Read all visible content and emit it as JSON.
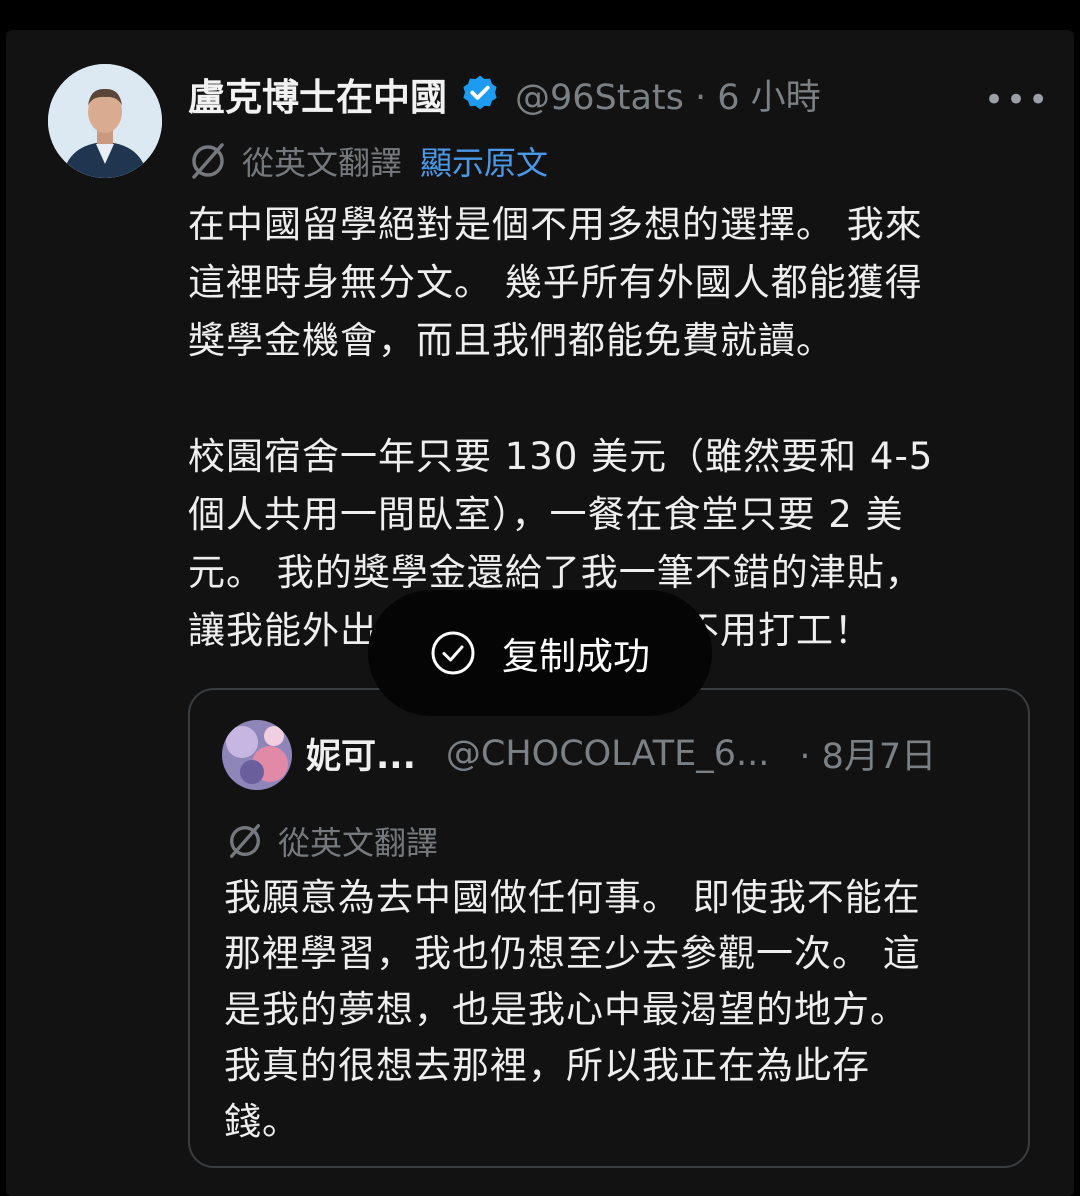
{
  "tweet": {
    "display_name": "盧克博士在中國",
    "handle_time": "@96Stats · 6 小時",
    "more": "•••",
    "translated_label": "從英文翻譯",
    "show_original": "顯示原文",
    "paragraph1": [
      "在中國留學絕對是個不用多想的選擇。 我來",
      "這裡時身無分文。 幾乎所有外國人都能獲得",
      "獎學金機會，而且我們都能免費就讀。"
    ],
    "paragraph2": [
      "校園宿舍一年只要 130 美元（雖然要和 4-5",
      "個人共用一間臥室），一餐在食堂只要 2 美",
      "元。 我的獎學金還給了我一筆不錯的津貼，",
      "讓我能外出好好享受生活，也不用打工！"
    ]
  },
  "toast": {
    "text": "复制成功"
  },
  "quoted": {
    "display_name": "妮可...",
    "handle": "@CHOCOLATE_6...",
    "date": "· 8月7日",
    "translated_label": "從英文翻譯",
    "lines": [
      "我願意為去中國做任何事。 即使我不能在",
      "那裡學習，我也仍想至少去參觀一次。 這",
      "是我的夢想，也是我心中最渴望的地方。",
      "我真的很想去那裡，所以我正在為此存",
      "錢。"
    ]
  },
  "colors": {
    "background": "#121212",
    "link": "#4a99e9",
    "verified": "#1d9bf0",
    "muted": "#7b8085"
  },
  "icons": [
    "verified-badge-icon",
    "translate-icon",
    "more-icon",
    "check-circle-icon"
  ]
}
